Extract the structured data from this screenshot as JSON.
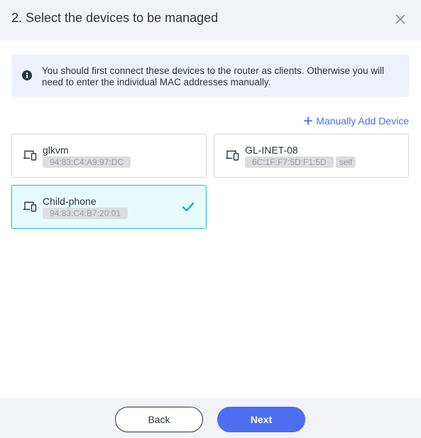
{
  "dialog": {
    "title": "2. Select the devices to be managed",
    "close_icon": "close-icon"
  },
  "notice": {
    "icon": "info-icon",
    "text": "You should first connect these devices to the router as clients. Otherwise you will need to enter the individual MAC addresses manually."
  },
  "add_device": {
    "icon": "plus-icon",
    "label": "Manually Add Device"
  },
  "devices": [
    {
      "name": "glkvm",
      "mac": "94:83:C4:A9:97:DC",
      "selected": false,
      "icon": "devices-icon"
    },
    {
      "name": "GL-INET-08",
      "mac": "6C:1F:F7:5D:F1:5D",
      "badge": "self",
      "selected": false,
      "icon": "devices-icon"
    },
    {
      "name": "Child-phone",
      "mac": "94:83:C4:B7:20:01",
      "selected": true,
      "icon": "devices-icon"
    }
  ],
  "footer": {
    "back_label": "Back",
    "next_label": "Next"
  },
  "colors": {
    "accent": "#4d6ef0",
    "selected_border": "#26b5c2",
    "selected_bg": "#e8fbfb",
    "check": "#1bb3c9"
  }
}
